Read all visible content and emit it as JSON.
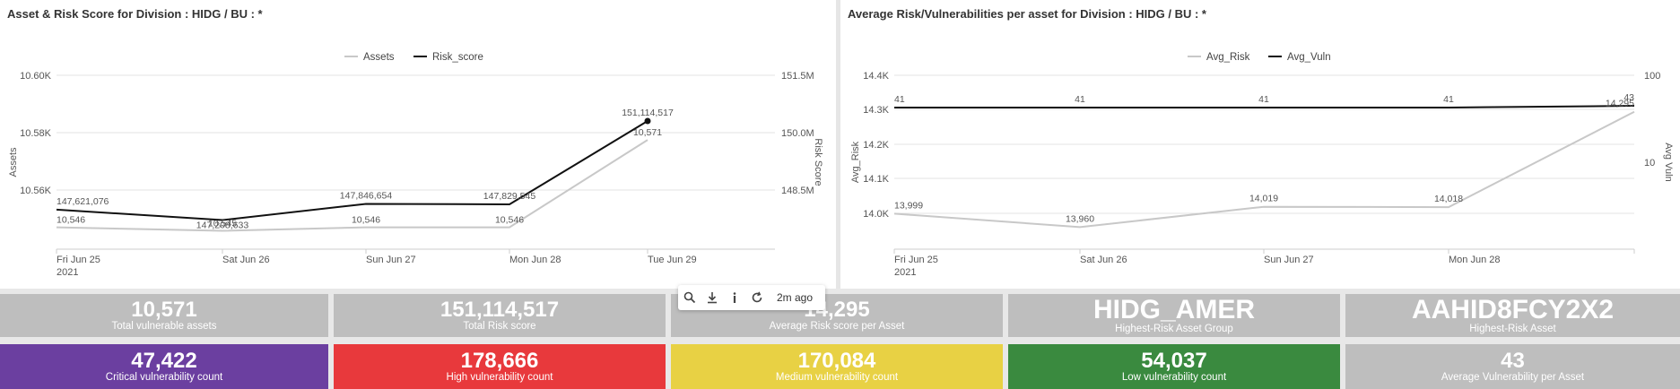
{
  "panels": [
    {
      "title": "Asset & Risk Score for Division : HIDG / BU : *"
    },
    {
      "title": "Average Risk/Vulnerabilities per asset for Division : HIDG / BU : *"
    }
  ],
  "chart_data": [
    {
      "type": "line",
      "title": "Asset & Risk Score for Division : HIDG / BU : *",
      "x": [
        "Fri Jun 25",
        "Sat Jun 26",
        "Sun Jun 27",
        "Mon Jun 28",
        "Tue Jun 29"
      ],
      "x_tick_labels": [
        "Fri Jun 25",
        "Sat Jun 26",
        "Sun Jun 27",
        "Mon Jun 28",
        "Tue Jun 29"
      ],
      "x_sublabel": "2021",
      "legend_position": "top-center",
      "grid": true,
      "y_left": {
        "label": "Assets",
        "ticks": [
          "10.56K",
          "10.58K",
          "10.60K"
        ],
        "range": [
          10540,
          10600
        ]
      },
      "y_right": {
        "label": "Risk Score",
        "ticks": [
          "148.5M",
          "150.0M",
          "151.5M"
        ],
        "range": [
          147000000,
          151500000
        ]
      },
      "series": [
        {
          "name": "Assets",
          "axis": "left",
          "color": "#c8c8c8",
          "values": [
            10546,
            10545,
            10546,
            10546,
            10571
          ],
          "labels": [
            "10,546",
            "10,545",
            "10,546",
            "10,546",
            "10,571"
          ]
        },
        {
          "name": "Risk_score",
          "axis": "right",
          "color": "#111111",
          "values": [
            147621076,
            147208633,
            147846654,
            147829545,
            151114517
          ],
          "labels": [
            "147,621,076",
            "147,208,633",
            "147,846,654",
            "147,829,545",
            "151,114,517"
          ]
        }
      ]
    },
    {
      "type": "line",
      "title": "Average Risk/Vulnerabilities per asset for Division : HIDG / BU : *",
      "x": [
        "Fri Jun 25",
        "Sat Jun 26",
        "Sun Jun 27",
        "Mon Jun 28",
        "Tue Jun 29"
      ],
      "x_tick_labels": [
        "Fri Jun 25",
        "Sat Jun 26",
        "Sun Jun 27",
        "Mon Jun 28"
      ],
      "x_sublabel": "2021",
      "legend_position": "top-center",
      "grid": true,
      "y_left": {
        "label": "Avg_Risk",
        "ticks": [
          "14.0K",
          "14.1K",
          "14.2K",
          "14.3K",
          "14.4K"
        ],
        "range": [
          13930,
          14400
        ]
      },
      "y_right": {
        "label": "Avg Vuln",
        "ticks": [
          "10",
          "100"
        ],
        "scale": "log"
      },
      "series": [
        {
          "name": "Avg_Risk",
          "axis": "left",
          "color": "#c8c8c8",
          "values": [
            13999,
            13960,
            14019,
            14018,
            14295
          ],
          "labels": [
            "13,999",
            "13,960",
            "14,019",
            "14,018",
            "14,295"
          ]
        },
        {
          "name": "Avg_Vuln",
          "axis": "right",
          "color": "#111111",
          "values": [
            41,
            41,
            41,
            41,
            43
          ],
          "labels": [
            "41",
            "41",
            "41",
            "41",
            "43"
          ]
        }
      ]
    }
  ],
  "toolbar": {
    "time": "2m ago",
    "icons": [
      "search-icon",
      "download-icon",
      "info-icon",
      "refresh-icon"
    ]
  },
  "tiles_row1": [
    {
      "value": "10,571",
      "label": "Total vulnerable assets",
      "color": "#bebebe"
    },
    {
      "value": "151,114,517",
      "label": "Total Risk score",
      "color": "#bebebe"
    },
    {
      "value": "14,295",
      "label": "Average Risk score per Asset",
      "color": "#bebebe"
    },
    {
      "value": "HIDG_AMER",
      "label": "Highest-Risk Asset Group",
      "color": "#bebebe"
    },
    {
      "value": "AAHID8FCY2X2",
      "label": "Highest-Risk Asset",
      "color": "#bebebe"
    }
  ],
  "tiles_row2": [
    {
      "value": "47,422",
      "label": "Critical vulnerability count",
      "color": "#6b3fa0"
    },
    {
      "value": "178,666",
      "label": "High vulnerability count",
      "color": "#e8393c"
    },
    {
      "value": "170,084",
      "label": "Medium vulnerability count",
      "color": "#e8d144"
    },
    {
      "value": "54,037",
      "label": "Low vulnerability count",
      "color": "#3a8a3f"
    },
    {
      "value": "43",
      "label": "Average Vulnerability per Asset",
      "color": "#bebebe"
    }
  ]
}
